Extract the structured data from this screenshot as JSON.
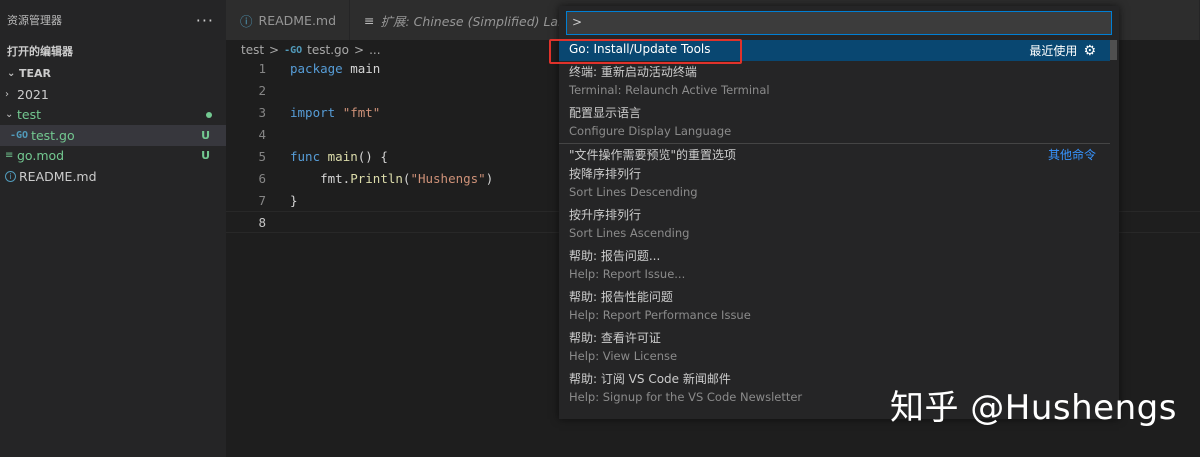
{
  "sidebar": {
    "title": "资源管理器",
    "more": "···",
    "open_editors": "打开的编辑器",
    "folder": "TEAR",
    "tree": [
      {
        "label": "2021",
        "kind": "folder"
      },
      {
        "label": "test",
        "kind": "folder",
        "status": "dot"
      },
      {
        "label": "test.go",
        "kind": "go",
        "status": "U"
      },
      {
        "label": "go.mod",
        "kind": "file",
        "status": "U"
      },
      {
        "label": "README.md",
        "kind": "info"
      }
    ]
  },
  "tabs": [
    {
      "icon": "ⓘ",
      "label": "README.md"
    },
    {
      "icon": "≡",
      "label": "扩展: Chinese (Simplified) Language"
    }
  ],
  "breadcrumb": {
    "folder": "test",
    "sep1": ">",
    "icon": "-GO",
    "file": "test.go",
    "sep2": ">",
    "rest": "..."
  },
  "code": {
    "lines": [
      "1",
      "2",
      "3",
      "4",
      "5",
      "6",
      "7",
      "8"
    ],
    "l1": [
      "package",
      " main"
    ],
    "l3": [
      "import",
      " ",
      "\"fmt\""
    ],
    "l5": [
      "func",
      " ",
      "main",
      "() {"
    ],
    "l6": [
      "    fmt.",
      "Println",
      "(",
      "\"Hushengs\"",
      ")"
    ],
    "l7": "}"
  },
  "palette": {
    "input": ">",
    "items": [
      {
        "label": "Go: Install/Update Tools",
        "right": "最近使用",
        "gear": "⚙"
      },
      {
        "label": "终端: 重新启动活动终端",
        "detail": "Terminal: Relaunch Active Terminal"
      },
      {
        "label": "配置显示语言",
        "detail": "Configure Display Language"
      },
      {
        "label": "\"文件操作需要预览\"的重置选项",
        "right_link": "其他命令"
      },
      {
        "label": "按降序排列行",
        "detail": "Sort Lines Descending"
      },
      {
        "label": "按升序排列行",
        "detail": "Sort Lines Ascending"
      },
      {
        "label": "帮助: 报告问题...",
        "detail": "Help: Report Issue..."
      },
      {
        "label": "帮助: 报告性能问题",
        "detail": "Help: Report Performance Issue"
      },
      {
        "label": "帮助: 查看许可证",
        "detail": "Help: View License"
      },
      {
        "label": "帮助: 订阅 VS Code 新闻邮件",
        "detail": "Help: Signup for the VS Code Newsletter"
      }
    ]
  },
  "watermark": "知乎 @Hushengs"
}
